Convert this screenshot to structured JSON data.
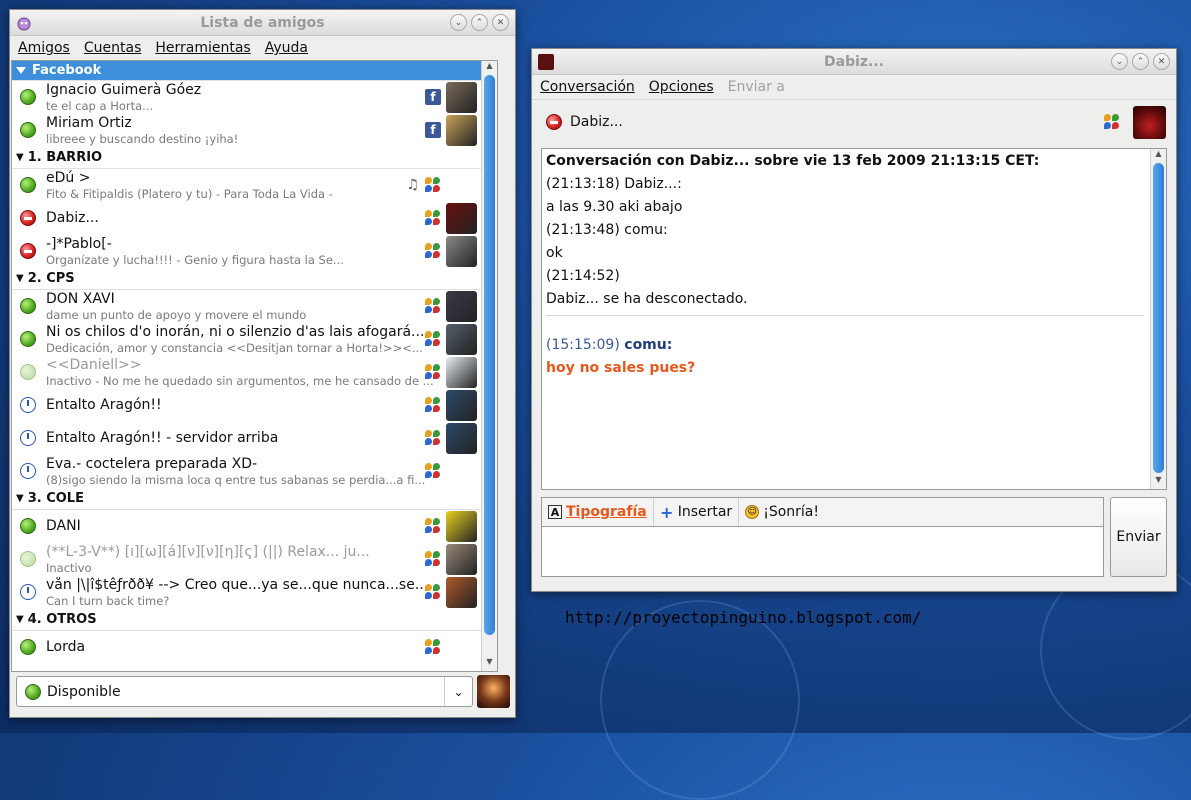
{
  "buddy_window": {
    "title": "Lista de amigos",
    "menu": [
      "Amigos",
      "Cuentas",
      "Herramientas",
      "Ayuda"
    ],
    "status": {
      "label": "Disponible"
    }
  },
  "groups": [
    {
      "name": "Facebook",
      "style": "facebook",
      "buddies": [
        {
          "name": "Ignacio Guimerà Góez",
          "status_text": "te el cap a Horta...",
          "state": "avail",
          "proto": "facebook",
          "avatar_color": "#7a6a5a"
        },
        {
          "name": "Miriam Ortiz",
          "status_text": "libreee y buscando destino ¡yiha!",
          "state": "avail",
          "proto": "facebook",
          "avatar_color": "#c9a35a"
        }
      ]
    },
    {
      "name": "1. BARRIO",
      "style": "normal",
      "buddies": [
        {
          "name": "eDú >",
          "status_text": "Fito & Fitipaldis (Platero y tu) - Para Toda La Vida -",
          "state": "avail",
          "proto": "msn",
          "music": true
        },
        {
          "name": "Dabiz...",
          "status_text": "",
          "state": "busy",
          "proto": "msn",
          "avatar_color": "#6a1010"
        },
        {
          "name": "-]*Pablo[-",
          "status_text": "Organízate y lucha!!!!                        - Genio y figura hasta la Se...",
          "state": "busy",
          "proto": "msn",
          "avatar_color": "#8a8a8a"
        }
      ]
    },
    {
      "name": "2. CPS",
      "style": "normal",
      "buddies": [
        {
          "name": "DON XAVI",
          "status_text": "dame un punto de apoyo y movere el mundo",
          "state": "avail",
          "proto": "msn",
          "avatar_color": "#3a3a4a"
        },
        {
          "name": "Ni os chilos d'o inorán, ni o silenzio d'as lais afogará...",
          "status_text": "Dedicación, amor y constancia <<Desitjan tornar a Horta!>><...",
          "state": "avail",
          "proto": "msn",
          "avatar_color": "#55606a"
        },
        {
          "name": "<<Daniell>>",
          "status_text": "Inactivo - No me he quedado sin argumentos, me he cansado de ...",
          "state": "idle",
          "proto": "msn",
          "gray": true,
          "avatar_color": "#e6ecf2"
        },
        {
          "name": "Entalto Aragón!!",
          "status_text": "",
          "state": "away",
          "proto": "msn",
          "avatar_color": "#2e4a6a"
        },
        {
          "name": "Entalto Aragón!! - servidor arriba",
          "status_text": "",
          "state": "away",
          "proto": "msn",
          "avatar_color": "#2e4a6a"
        },
        {
          "name": "Eva.- coctelera preparada XD-",
          "status_text": "(8)sigo siendo la misma loca q entre tus sabanas se perdia...a fi...",
          "state": "away",
          "proto": "msn"
        }
      ]
    },
    {
      "name": "3. COLE",
      "style": "normal",
      "buddies": [
        {
          "name": "DANI",
          "status_text": "",
          "state": "avail",
          "proto": "msn",
          "avatar_color": "#e8d020"
        },
        {
          "name": "(**L-3-V**)  [ı][ω][á][ν][ν][η][ς]   (||)             Relax... ju...",
          "status_text": "Inactivo",
          "state": "idle",
          "proto": "msn",
          "gray": true,
          "avatar_color": "#9a8a7a"
        },
        {
          "name": "vån |\\|î$têƒrðð¥ --> Creo que...ya se...que nunca...se...",
          "status_text": "Can I turn back time?",
          "state": "away",
          "proto": "msn",
          "avatar_color": "#b05a2a"
        }
      ]
    },
    {
      "name": "4. OTROS",
      "style": "normal",
      "buddies": [
        {
          "name": "Lorda",
          "status_text": "",
          "state": "avail",
          "proto": "msn"
        }
      ]
    }
  ],
  "conv_window": {
    "title": "Dabiz...",
    "menu": [
      "Conversación",
      "Opciones",
      "Enviar a"
    ],
    "contact_name": "Dabiz...",
    "log": {
      "header": "Conversación con Dabiz... sobre vie 13 feb 2009 21:13:15 CET:",
      "lines": [
        "(21:13:18) Dabiz...:",
        "a las 9.30 aki abajo",
        "(21:13:48) comu:",
        "ok",
        "(21:14:52)",
        "Dabiz... se ha desconectado."
      ],
      "new_ts": "(15:15:09)",
      "new_sender": "comu:",
      "new_msg": "hoy no sales pues?"
    },
    "toolbar": {
      "font": "Tipografía",
      "insert": "Insertar",
      "smile": "¡Sonría!"
    },
    "send_label": "Enviar"
  },
  "watermark_url": "http://proyectopinguino.blogspot.com/"
}
